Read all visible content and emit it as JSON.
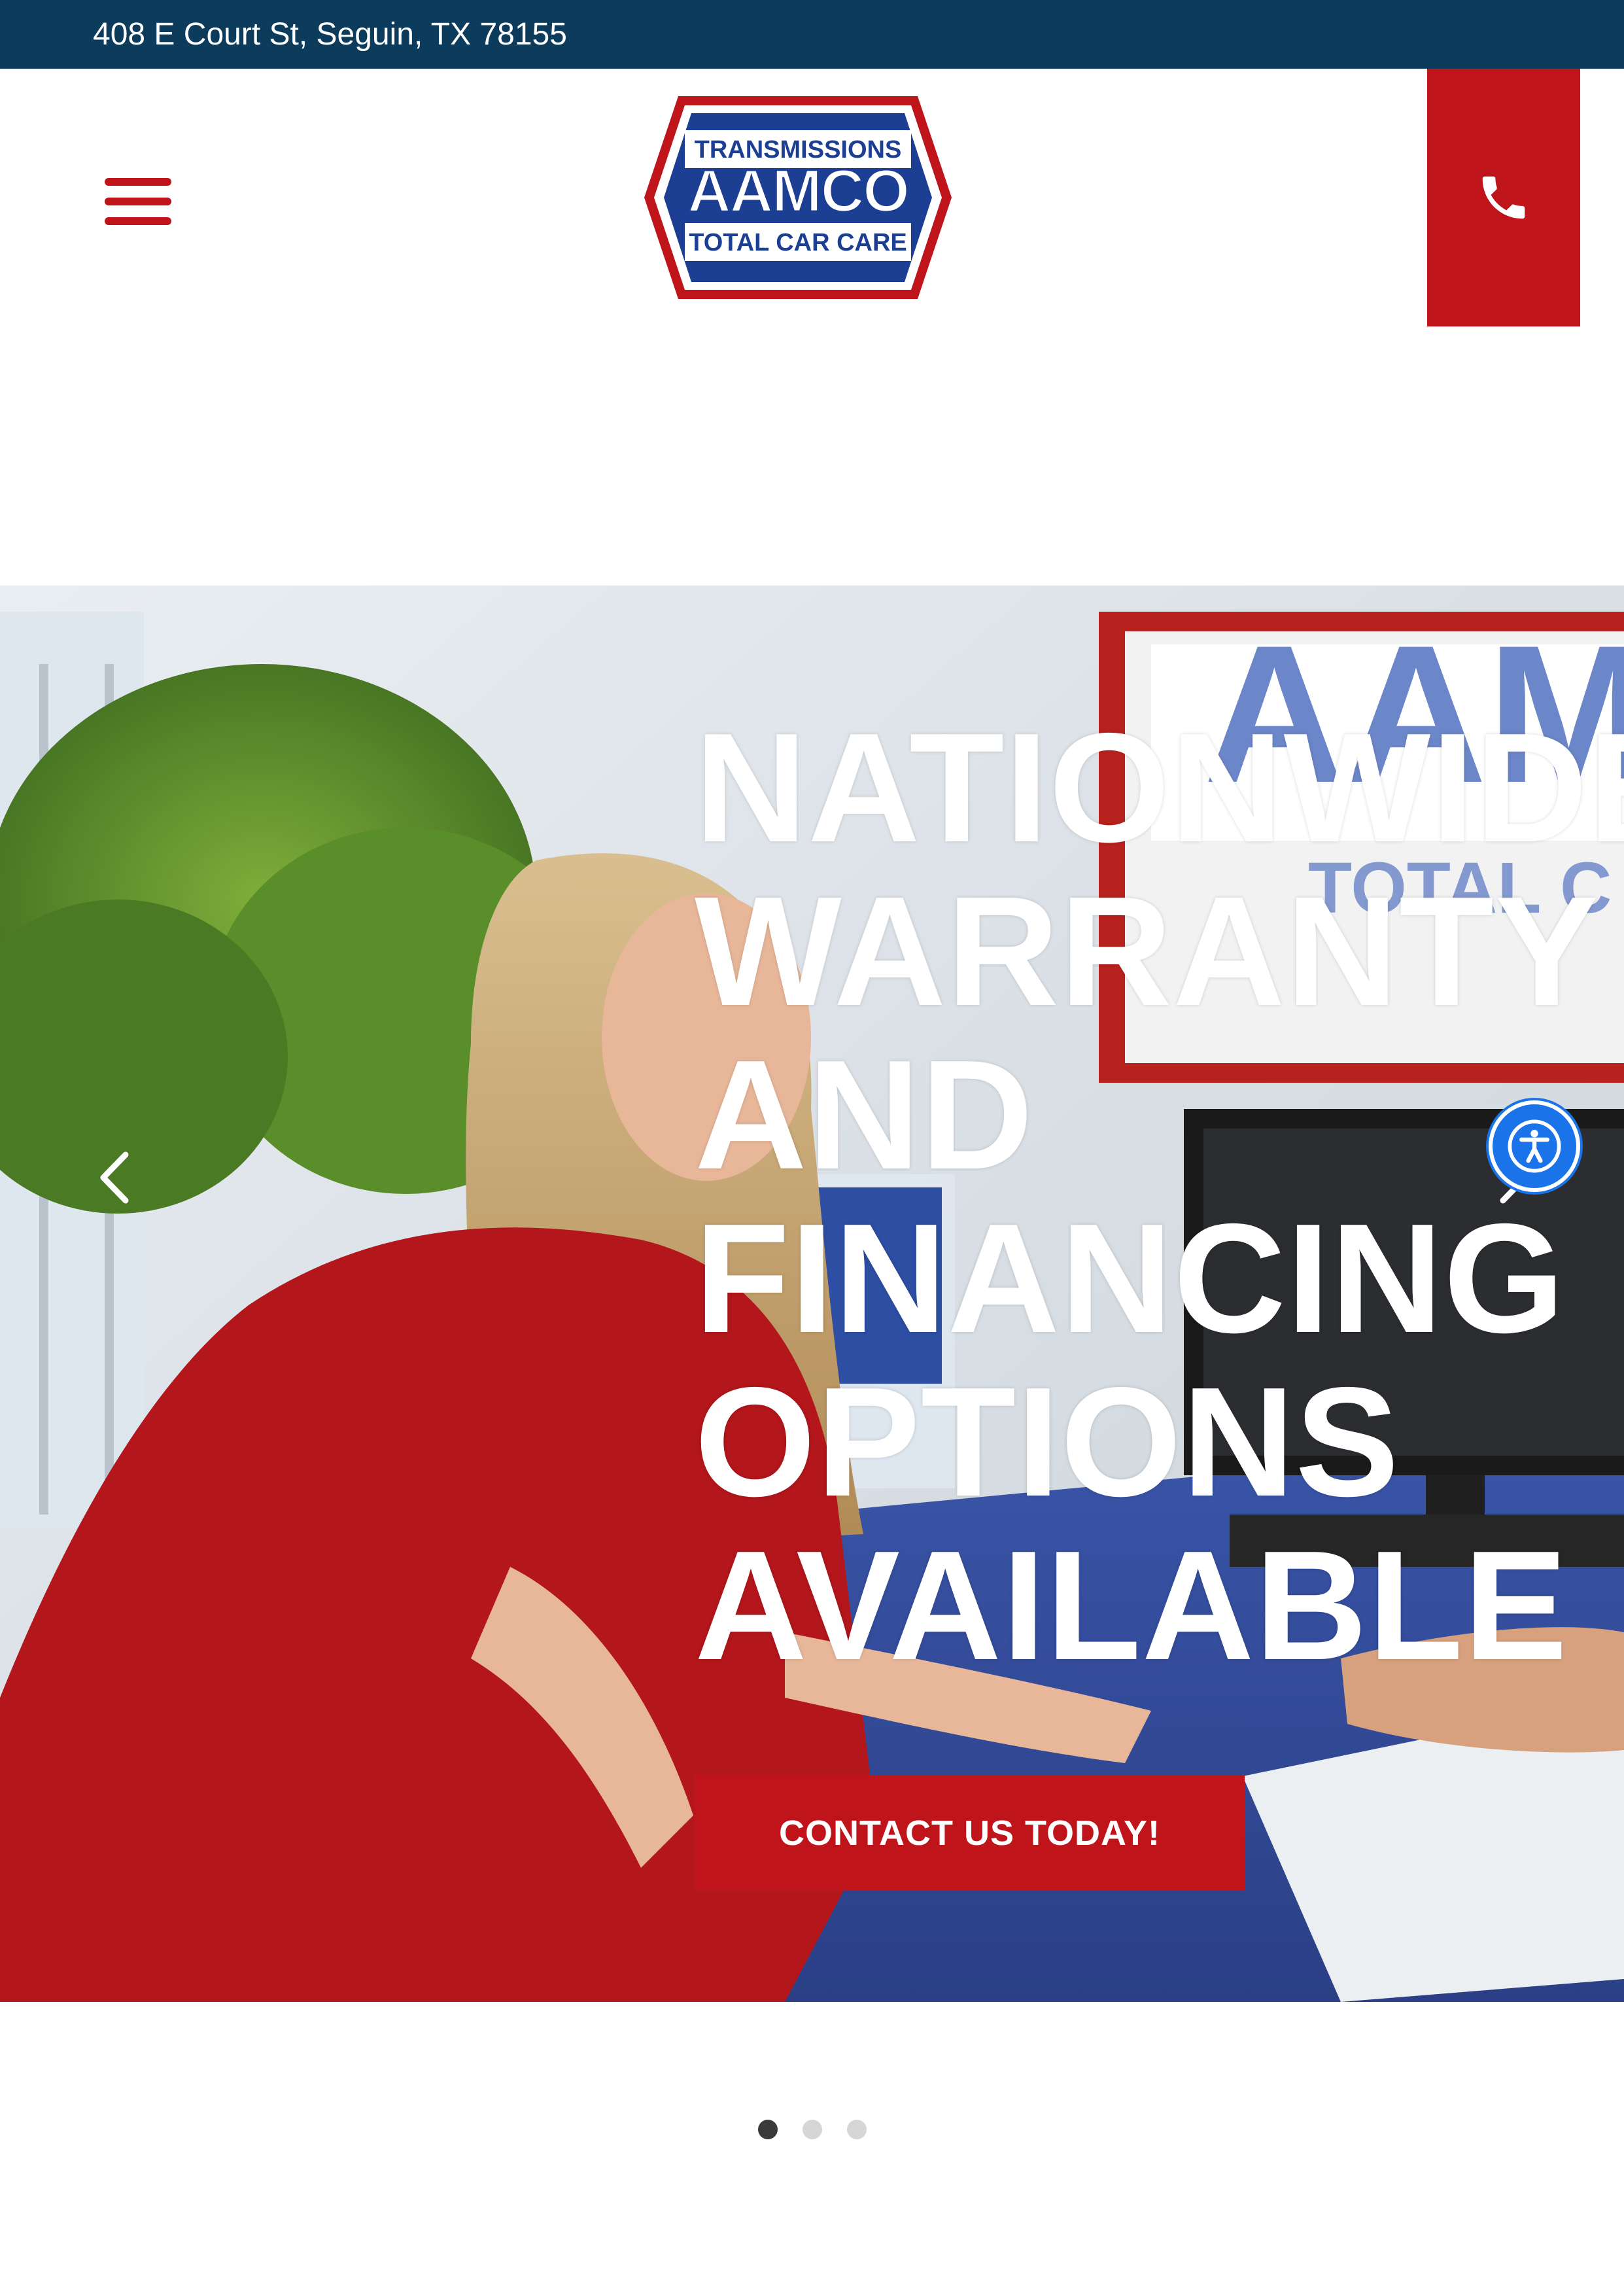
{
  "topbar": {
    "address": "408 E Court St, Seguin, TX 78155"
  },
  "header": {
    "menu_icon": "hamburger-menu-icon",
    "logo": {
      "top_text": "TRANSMISSIONS",
      "brand": "AAMCO",
      "bottom_text": "TOTAL CAR CARE",
      "colors": {
        "red": "#c0141b",
        "blue": "#1c3f94",
        "white": "#ffffff"
      }
    },
    "phone_icon": "phone-icon"
  },
  "hero": {
    "heading": "NATIONWIDE\nWARRANTY\nAND\nFINANCING\nOPTIONS\nAVAILABLE",
    "cta_label": "CONTACT US TODAY!",
    "prev_icon": "chevron-left-icon",
    "next_icon": "chevron-right-icon",
    "sign_text": "AAMCO",
    "sign_subtext": "TOTAL C"
  },
  "accessibility": {
    "icon": "accessibility-icon"
  },
  "slider": {
    "slide_count": 3,
    "active_index": 0
  },
  "colors": {
    "topbar": "#0d3b5c",
    "accent_red": "#c0141b",
    "accessibility_blue": "#1a73e8",
    "dot_active": "#3a3a3a",
    "dot_inactive": "#d6d6d6"
  }
}
